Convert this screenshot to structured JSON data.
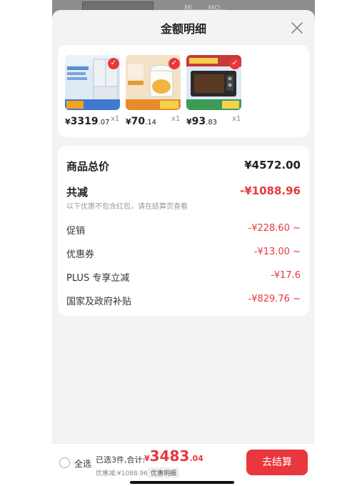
{
  "colors": {
    "accent": "#e8383d",
    "background": "#f3f3f3",
    "card": "#ffffff"
  },
  "sheet": {
    "title": "金额明细",
    "close_icon": "close-icon"
  },
  "products": [
    {
      "yen": "¥",
      "price_int": "3319",
      "price_dec": ".07",
      "qty": "x1",
      "image": "refrigerator-image"
    },
    {
      "yen": "¥",
      "price_int": "70",
      "price_dec": ".14",
      "qty": "x1",
      "image": "food-processor-image"
    },
    {
      "yen": "¥",
      "price_int": "93",
      "price_dec": ".83",
      "qty": "x1",
      "image": "oven-image"
    }
  ],
  "summary": {
    "total_label": "商品总价",
    "total_value": "¥4572.00",
    "reduce_label": "共减",
    "reduce_value": "-¥1088.96",
    "reduce_note": "以下优惠不包含红包，请在结算页查看",
    "items": [
      {
        "label": "促销",
        "value": "-¥228.60",
        "chevron": "~"
      },
      {
        "label": "优惠券",
        "value": "-¥13.00",
        "chevron": "~"
      },
      {
        "label": "PLUS 专享立减",
        "value": "-¥17.6",
        "chevron": ""
      },
      {
        "label": "国家及政府补贴",
        "value": "-¥829.76",
        "chevron": "~"
      }
    ]
  },
  "bottom": {
    "select_all": "全选",
    "selected_info": "已选3件,合计:",
    "total_yen": "¥",
    "total_int": "3483",
    "total_dec": ".04",
    "discount_text": "优惠减:¥1088.96",
    "detail_tag": "优惠明细",
    "checkout_label": "去结算"
  }
}
